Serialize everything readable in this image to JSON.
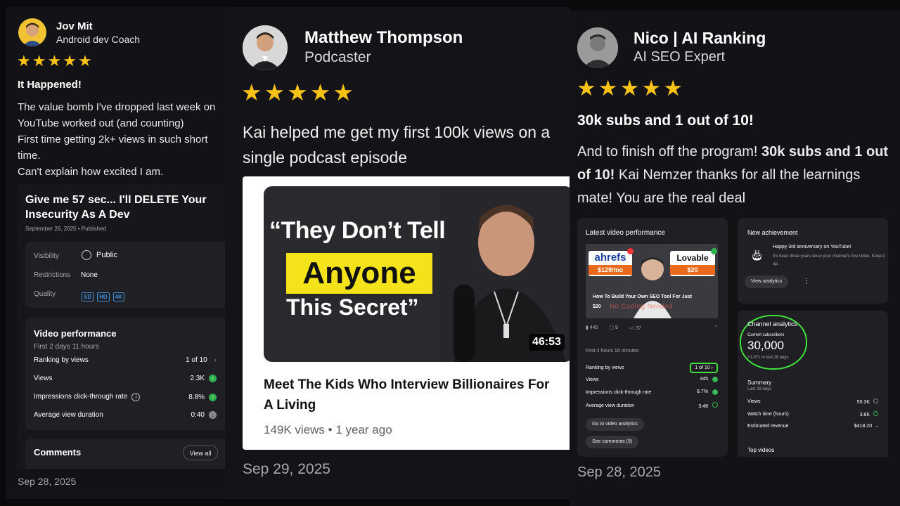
{
  "testimonials": [
    {
      "name": "Jov Mit",
      "role": "Android dev Coach",
      "rating": 5,
      "headline": "It Happened!",
      "body_lines": [
        "The value bomb I've dropped last week on",
        "YouTube worked out (and counting)",
        "First time getting 2k+ views in such short",
        "time.",
        "Can't explain how excited I am."
      ],
      "date": "Sep 28, 2025",
      "screenshot": {
        "video_title": "Give me 57 sec... I'll DELETE Your Insecurity As A Dev",
        "published": "September 26, 2025 • Published",
        "details": [
          {
            "label": "Visibility",
            "value": "Public",
            "icon": "globe-icon"
          },
          {
            "label": "Restrictions",
            "value": "None"
          },
          {
            "label": "Quality",
            "badges": [
              "SD",
              "HD",
              "4K"
            ]
          }
        ],
        "performance": {
          "title": "Video performance",
          "subtitle": "First 2 days 11 hours",
          "rows": [
            {
              "label": "Ranking by views",
              "value": "1 of 10",
              "icon": "chevron-right-icon"
            },
            {
              "label": "Views",
              "value": "2.3K",
              "icon": "arrow-up-icon"
            },
            {
              "label": "Impressions click-through rate",
              "value": "8.8%",
              "icon": "arrow-up-icon"
            },
            {
              "label": "Average view duration",
              "value": "0:40",
              "icon": "arrow-down-icon"
            }
          ]
        },
        "comments": {
          "title": "Comments",
          "button": "View all"
        }
      }
    },
    {
      "name": "Matthew Thompson",
      "role": "Podcaster",
      "rating": 5,
      "body": "Kai helped me get my first 100k views on a single podcast episode",
      "date": "Sep 29, 2025",
      "video": {
        "thumb_line1": "“They Don’t Tell",
        "thumb_line2": "Anyone",
        "thumb_line3": "This Secret”",
        "duration": "46:53",
        "title": "Meet The Kids Who Interview Billionaires For A Living",
        "meta": "149K views • 1 year ago",
        "colors": {
          "highlight": "#f4e21a",
          "thumb_bg": "#2a2a2e"
        }
      }
    },
    {
      "name": "Nico | AI Ranking",
      "role": "AI SEO Expert",
      "rating": 5,
      "headline": "30k subs and 1 out of 10!",
      "body_pre": "And to finish off the program! ",
      "body_bold": "30k subs and 1 out of 10!",
      "body_post": " Kai Nemzer thanks for all the learnings mate! You are the real deal",
      "date": "Sep 28, 2025",
      "screenshot": {
        "latest": {
          "title": "Latest video performance",
          "thumb": {
            "brand1": "ahrefs",
            "price1": "$129/mo",
            "brand2": "Lovable",
            "price2": "$20",
            "caption": "How To Build Your Own SEO Tool For Just",
            "caption_price": "$20",
            "caption_faded": "No Coding Needed"
          },
          "stats": [
            "445",
            "9",
            "37"
          ],
          "subtitle": "First 3 hours 16 minutes",
          "rows": [
            {
              "label": "Ranking by views",
              "value": "1 of 10"
            },
            {
              "label": "Views",
              "value": "445"
            },
            {
              "label": "Impressions click-through rate",
              "value": "8.7%"
            },
            {
              "label": "Average view duration",
              "value": "3:48"
            }
          ],
          "buttons": [
            "Go to video analytics",
            "See comments (9)"
          ]
        },
        "achievement": {
          "title": "New achievement",
          "headline": "Happy 3rd anniversary on YouTube!",
          "text": "It's been three years since your channel's first video. Keep it up.",
          "button": "View analytics"
        },
        "channel": {
          "title": "Channel analytics",
          "subs_label": "Current subscribers",
          "subs_value": "30,000",
          "subs_change": "+1,071 in last 28 days",
          "summary_title": "Summary",
          "summary_sub": "Last 28 days",
          "summary_rows": [
            {
              "label": "Views",
              "value": "55.3K"
            },
            {
              "label": "Watch time (hours)",
              "value": "3.8K"
            },
            {
              "label": "Estimated revenue",
              "value": "$418.20"
            }
          ],
          "top_videos": "Top videos",
          "circle_color": "#3ee23a"
        }
      }
    }
  ]
}
